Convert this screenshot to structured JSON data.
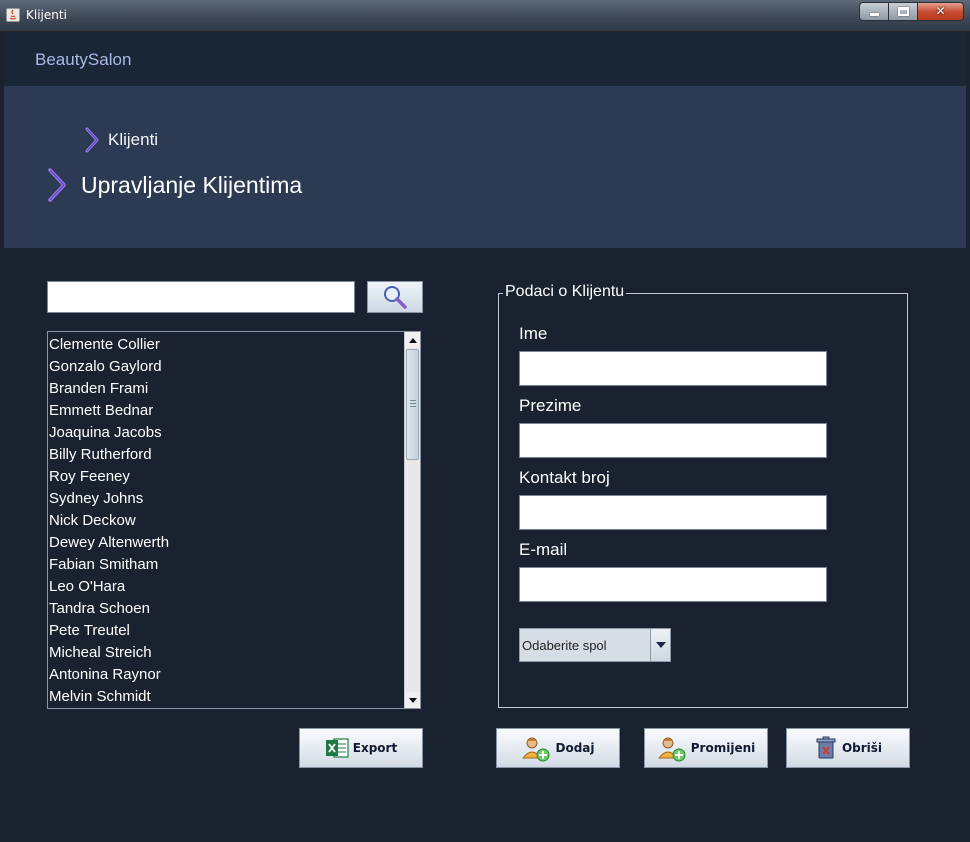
{
  "window": {
    "title": "Klijenti"
  },
  "header": {
    "brand": "BeautySalon"
  },
  "breadcrumb": {
    "label": "Klijenti"
  },
  "page": {
    "heading": "Upravljanje Klijentima"
  },
  "search": {
    "value": "",
    "placeholder": ""
  },
  "clients": [
    "Clemente Collier",
    "Gonzalo Gaylord",
    "Branden Frami",
    "Emmett Bednar",
    "Joaquina Jacobs",
    "Billy Rutherford",
    "Roy Feeney",
    "Sydney Johns",
    "Nick Deckow",
    "Dewey Altenwerth",
    "Fabian Smitham",
    "Leo O'Hara",
    "Tandra Schoen",
    "Pete Treutel",
    "Micheal Streich",
    "Antonina Raynor",
    "Melvin Schmidt"
  ],
  "form": {
    "legend": "Podaci o Klijentu",
    "ime_label": "Ime",
    "prezime_label": "Prezime",
    "kontakt_label": "Kontakt broj",
    "email_label": "E-mail",
    "ime_value": "",
    "prezime_value": "",
    "kontakt_value": "",
    "email_value": "",
    "spol_selected": "Odaberite spol"
  },
  "buttons": {
    "export": "Export",
    "dodaj": "Dodaj",
    "promijeni": "Promijeni",
    "obrisi": "Obriši"
  },
  "colors": {
    "background": "#1a2230",
    "hero": "#2c3b53",
    "brand_text": "#a9b9e6",
    "chevron": "#9a7cf0"
  },
  "icons": {
    "search": "magnifier-icon",
    "export": "excel-icon",
    "dodaj": "add-user-icon",
    "promijeni": "edit-user-icon",
    "obrisi": "trash-icon"
  }
}
